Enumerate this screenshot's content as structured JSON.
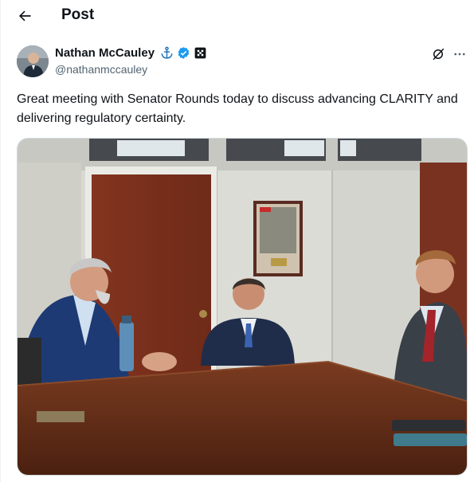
{
  "header": {
    "title": "Post",
    "back_icon": "arrow-left-icon"
  },
  "author": {
    "name": "Nathan McCauley",
    "handle": "@nathanmccauley",
    "badges": [
      "anchor-icon",
      "verified-badge-icon",
      "affiliate-badge-icon"
    ]
  },
  "actions": {
    "grok_icon": "grok-icon",
    "more_icon": "more-horizontal-icon"
  },
  "post": {
    "text": "Great meeting with Senator Rounds today to discuss advancing CLARITY and delivering regulatory certainty.",
    "media_kind": "photo"
  },
  "colors": {
    "text": "#0f1419",
    "secondary": "#536471",
    "verified": "#1d9bf0"
  }
}
